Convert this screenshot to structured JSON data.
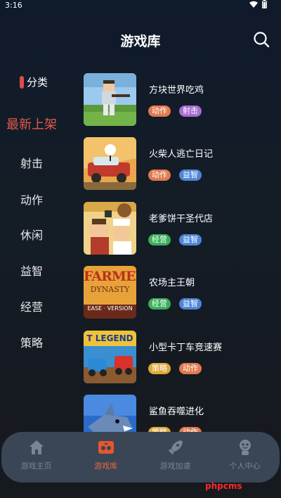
{
  "status_bar": {
    "time": "3:16"
  },
  "header": {
    "title": "游戏库"
  },
  "sidebar": {
    "header_label": "分类",
    "items": [
      {
        "label": "最新上架",
        "active": true
      },
      {
        "label": "射击"
      },
      {
        "label": "动作"
      },
      {
        "label": "休闲"
      },
      {
        "label": "益智"
      },
      {
        "label": "经营"
      },
      {
        "label": "策略"
      }
    ]
  },
  "games": [
    {
      "name": "方块世界吃鸡",
      "tags": [
        "动作",
        "射击"
      ]
    },
    {
      "name": "火柴人逃亡日记",
      "tags": [
        "动作",
        "益智"
      ]
    },
    {
      "name": "老爹饼干圣代店",
      "tags": [
        "经营",
        "益智"
      ]
    },
    {
      "name": "农场主王朝",
      "tags": [
        "经营",
        "益智"
      ],
      "thumb_text": {
        "line1": "FARMER",
        "line2": "DYNASTY",
        "line3": "EASE · VERSION"
      }
    },
    {
      "name": "小型卡丁车竞速赛",
      "tags": [
        "策略",
        "动作"
      ],
      "thumb_text": {
        "line1": "T LEGEND"
      }
    },
    {
      "name": "鲨鱼吞噬进化",
      "tags": [
        "策略",
        "动作"
      ]
    }
  ],
  "tag_colors": {
    "动作": "#e07a4e",
    "射击": "#a66bd0",
    "益智": "#4e86d8",
    "经营": "#3aae5a",
    "策略": "#e0a83a"
  },
  "tab_bar": {
    "tabs": [
      {
        "label": "游戏主页",
        "icon": "home-icon"
      },
      {
        "label": "游戏库",
        "icon": "gamepad-icon",
        "active": true
      },
      {
        "label": "游戏加速",
        "icon": "rocket-icon"
      },
      {
        "label": "个人中心",
        "icon": "user-icon"
      }
    ]
  },
  "watermark": "phpcms"
}
